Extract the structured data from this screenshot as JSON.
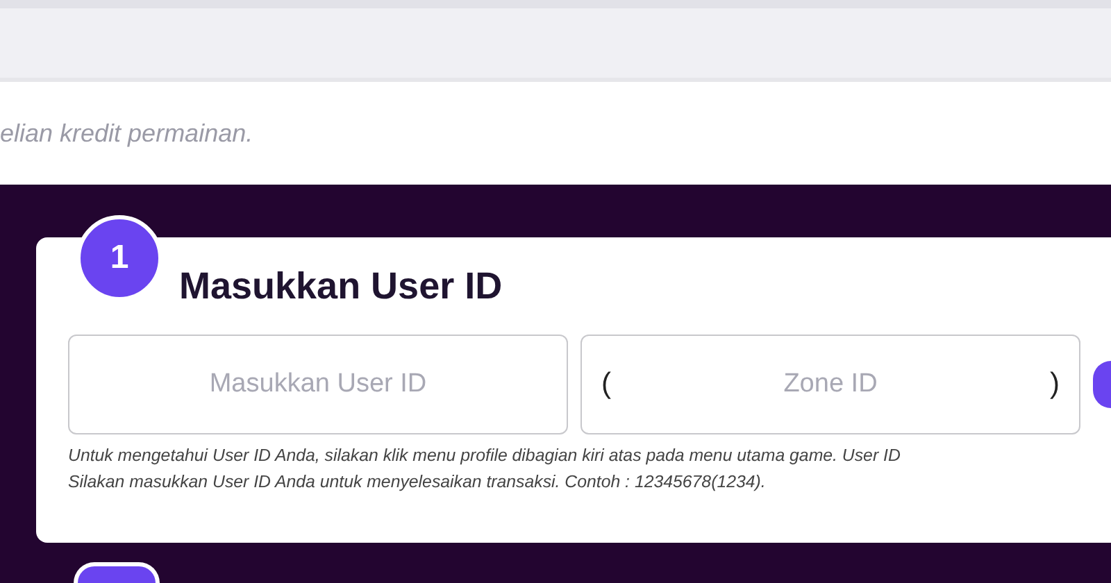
{
  "intro": {
    "text": "elian kredit permainan."
  },
  "steps": [
    {
      "number": "1",
      "title": "Masukkan User ID",
      "fields": [
        {
          "kind": "plain",
          "placeholder": "Masukkan User ID"
        },
        {
          "kind": "paren",
          "placeholder": "Zone ID",
          "open": "(",
          "close": ")"
        }
      ],
      "help": [
        "Untuk mengetahui User ID Anda, silakan klik menu profile dibagian kiri atas pada menu utama game. User ID",
        "Silakan masukkan User ID Anda untuk menyelesaikan transaksi. Contoh : 12345678(1234)."
      ]
    }
  ]
}
